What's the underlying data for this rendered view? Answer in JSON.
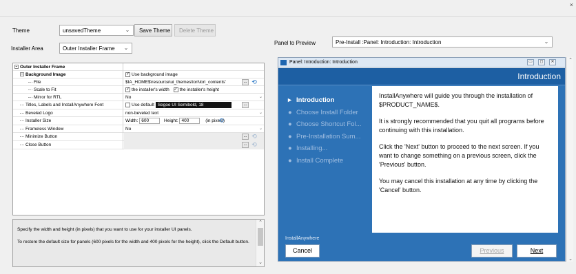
{
  "window": {
    "close_glyph": "×"
  },
  "theme": {
    "label": "Theme",
    "value": "unsavedTheme",
    "save_button": "Save Theme",
    "delete_button": "Delete Theme"
  },
  "installer_area": {
    "label": "Installer Area",
    "value": "Outer Installer Frame"
  },
  "panel_preview": {
    "label": "Panel to Preview",
    "value": "Pre-Install :Panel: Introduction: Introduction"
  },
  "properties": {
    "section": "Outer Installer Frame",
    "background_image": {
      "name": "Background Image",
      "value": "Use background image"
    },
    "file": {
      "name": "File",
      "value": "$IA_HOME$\\resource\\ui_themes\\lori\\lori_contents'"
    },
    "scale_to_fit": {
      "name": "Scale to Fit",
      "width_opt": "the installer's width",
      "height_opt": "the installer's height"
    },
    "mirror_rtl": {
      "name": "Mirror for RTL",
      "value": "No"
    },
    "font": {
      "name": "Titles, Labels and InstallAnywhere Font",
      "use_default": "Use default",
      "value": "Segoe UI Semibold, 18"
    },
    "beveled_logo": {
      "name": "Beveled Logo",
      "value": "non-beveled text"
    },
    "installer_size": {
      "name": "Installer Size",
      "width_label": "Width:",
      "width": "600",
      "height_label": "Height:",
      "height": "400",
      "unit": "(in pixels)"
    },
    "frameless": {
      "name": "Frameless Window",
      "value": "No"
    },
    "minimize": {
      "name": "Minimize Button"
    },
    "close": {
      "name": "Close Button"
    },
    "ellipsis": "..."
  },
  "description": {
    "p1": "Specify the width and height (in pixels) that you want to use for your installer UI panels.",
    "p2": "To restore the default size for panels (600 pixels for the width and 400 pixels for the height), click the Default button."
  },
  "preview": {
    "window_title": "Panel: Introduction: Introduction",
    "header_title": "Introduction",
    "steps": [
      {
        "label": "Introduction"
      },
      {
        "label": "Choose Install Folder"
      },
      {
        "label": "Choose Shortcut Fol..."
      },
      {
        "label": "Pre-Installation Sum..."
      },
      {
        "label": "Installing..."
      },
      {
        "label": "Install Complete"
      }
    ],
    "paragraphs": [
      "InstallAnywhere will guide you through the installation of $PRODUCT_NAME$.",
      "It is strongly recommended that you quit all programs before continuing with this installation.",
      "Click the 'Next' button to proceed to the next screen. If you want to change something on a previous screen, click the 'Previous' button.",
      "You may cancel this installation at any time by clicking the 'Cancel' button."
    ],
    "brand": "InstallAnywhere",
    "cancel": "Cancel",
    "previous": "Previous",
    "next": "Next"
  }
}
